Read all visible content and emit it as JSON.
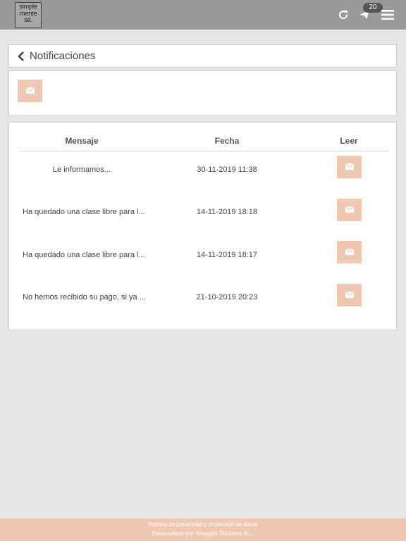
{
  "header": {
    "logo_lines": [
      "simple",
      "mente",
      "sé."
    ],
    "refresh_icon": "refresh-icon",
    "send_icon": "paper-plane-icon",
    "badge_count": "20",
    "menu_icon": "hamburger-menu-icon",
    "background_color": "#9a9a9a"
  },
  "page": {
    "title": "Notificaciones",
    "back_icon": "chevron-left-icon"
  },
  "actions": {
    "compose_icon": "envelope-icon"
  },
  "table": {
    "headers": {
      "message": "Mensaje",
      "date": "Fecha",
      "read": "Leer"
    },
    "rows": [
      {
        "message": "Le informamos...",
        "date": "30-11-2019 11:38"
      },
      {
        "message": "Ha quedado una clase libre para l...",
        "date": "14-11-2019 18:18"
      },
      {
        "message": "Ha quedado una clase libre para l...",
        "date": "14-11-2019 18:17"
      },
      {
        "message": "No hemos recibido su pago, si ya ...",
        "date": "21-10-2019 20:23"
      }
    ]
  },
  "footer": {
    "privacy_link": "Política de privacidad y protección de datos",
    "developer": "Desarrollado por Weappin Solutions S.L."
  },
  "colors": {
    "accent": "#f0c8b1",
    "background": "#e6e6e6"
  }
}
